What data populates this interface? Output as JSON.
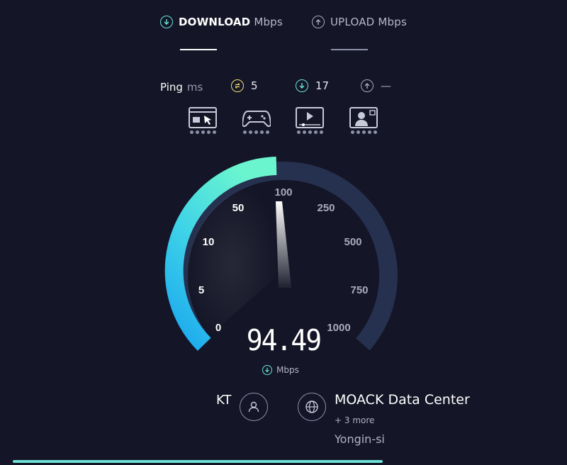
{
  "tabs": {
    "download": {
      "label": "DOWNLOAD",
      "unit": "Mbps"
    },
    "upload": {
      "label": "UPLOAD",
      "unit": "Mbps"
    }
  },
  "ping": {
    "label": "Ping",
    "unit": "ms",
    "idle": "5",
    "download": "17",
    "upload": "—"
  },
  "activities": [
    "browsing-icon",
    "gaming-icon",
    "video-streaming-icon",
    "video-call-icon"
  ],
  "gauge": {
    "ticks": [
      "0",
      "5",
      "10",
      "50",
      "100",
      "250",
      "500",
      "750",
      "1000"
    ],
    "value": "94.49",
    "unit": "Mbps"
  },
  "isp": {
    "name": "KT"
  },
  "server": {
    "name": "MOACK Data Center",
    "more": "+ 3 more",
    "location": "Yongin-si"
  },
  "colors": {
    "accent": "#67e6d6",
    "background": "#141526",
    "gauge_track": "#26304f",
    "ping_idle": "#f2e37a"
  },
  "progress": 0.65
}
